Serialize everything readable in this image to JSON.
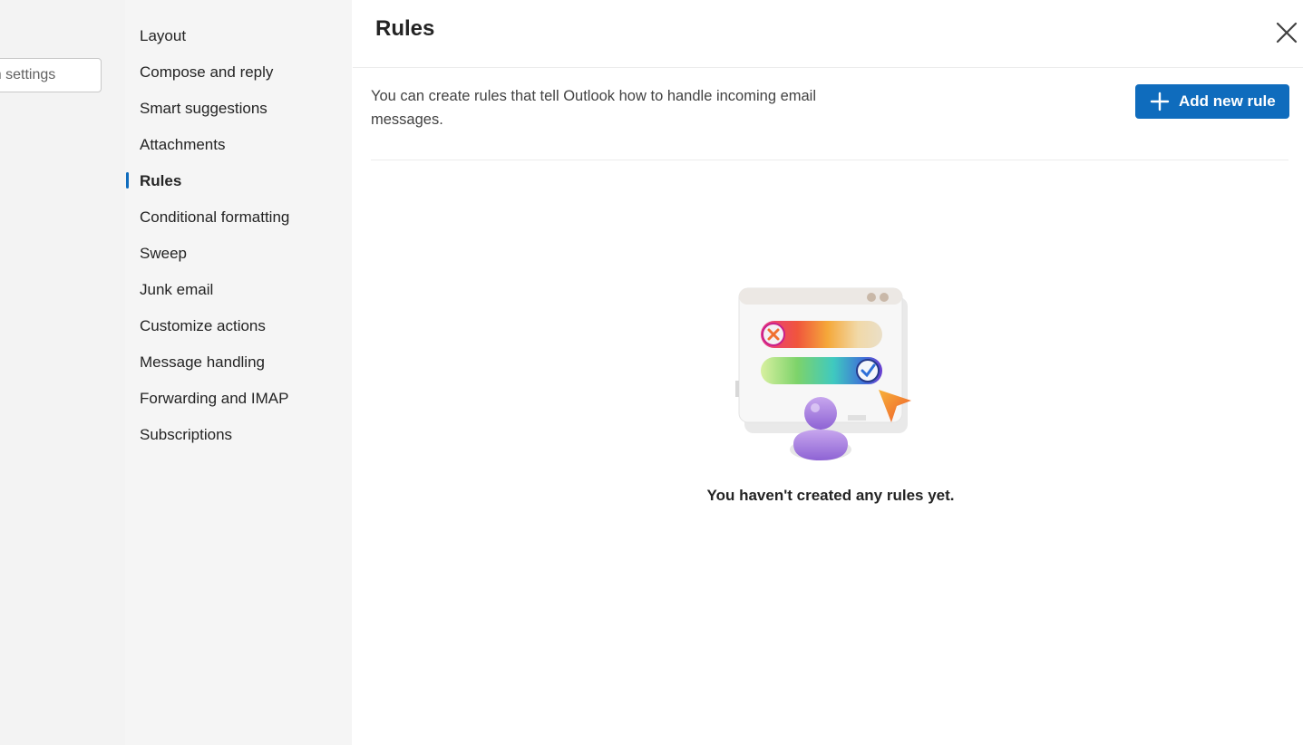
{
  "search": {
    "placeholder": "Search settings"
  },
  "nav": {
    "items": [
      {
        "label": "Layout"
      },
      {
        "label": "Compose and reply"
      },
      {
        "label": "Smart suggestions"
      },
      {
        "label": "Attachments"
      },
      {
        "label": "Rules",
        "active": true
      },
      {
        "label": "Conditional formatting"
      },
      {
        "label": "Sweep"
      },
      {
        "label": "Junk email"
      },
      {
        "label": "Customize actions"
      },
      {
        "label": "Message handling"
      },
      {
        "label": "Forwarding and IMAP"
      },
      {
        "label": "Subscriptions"
      }
    ]
  },
  "main": {
    "title": "Rules",
    "description": "You can create rules that tell Outlook how to handle incoming email messages.",
    "add_button_label": "Add new rule",
    "empty_state_text": "You haven't created any rules yet.",
    "close_icon": "close-icon",
    "illustration": "rules-empty-illustration"
  },
  "colors": {
    "accent": "#0f6cbd",
    "nav_background": "#f5f5f5",
    "left_background": "#f3f3f3"
  }
}
